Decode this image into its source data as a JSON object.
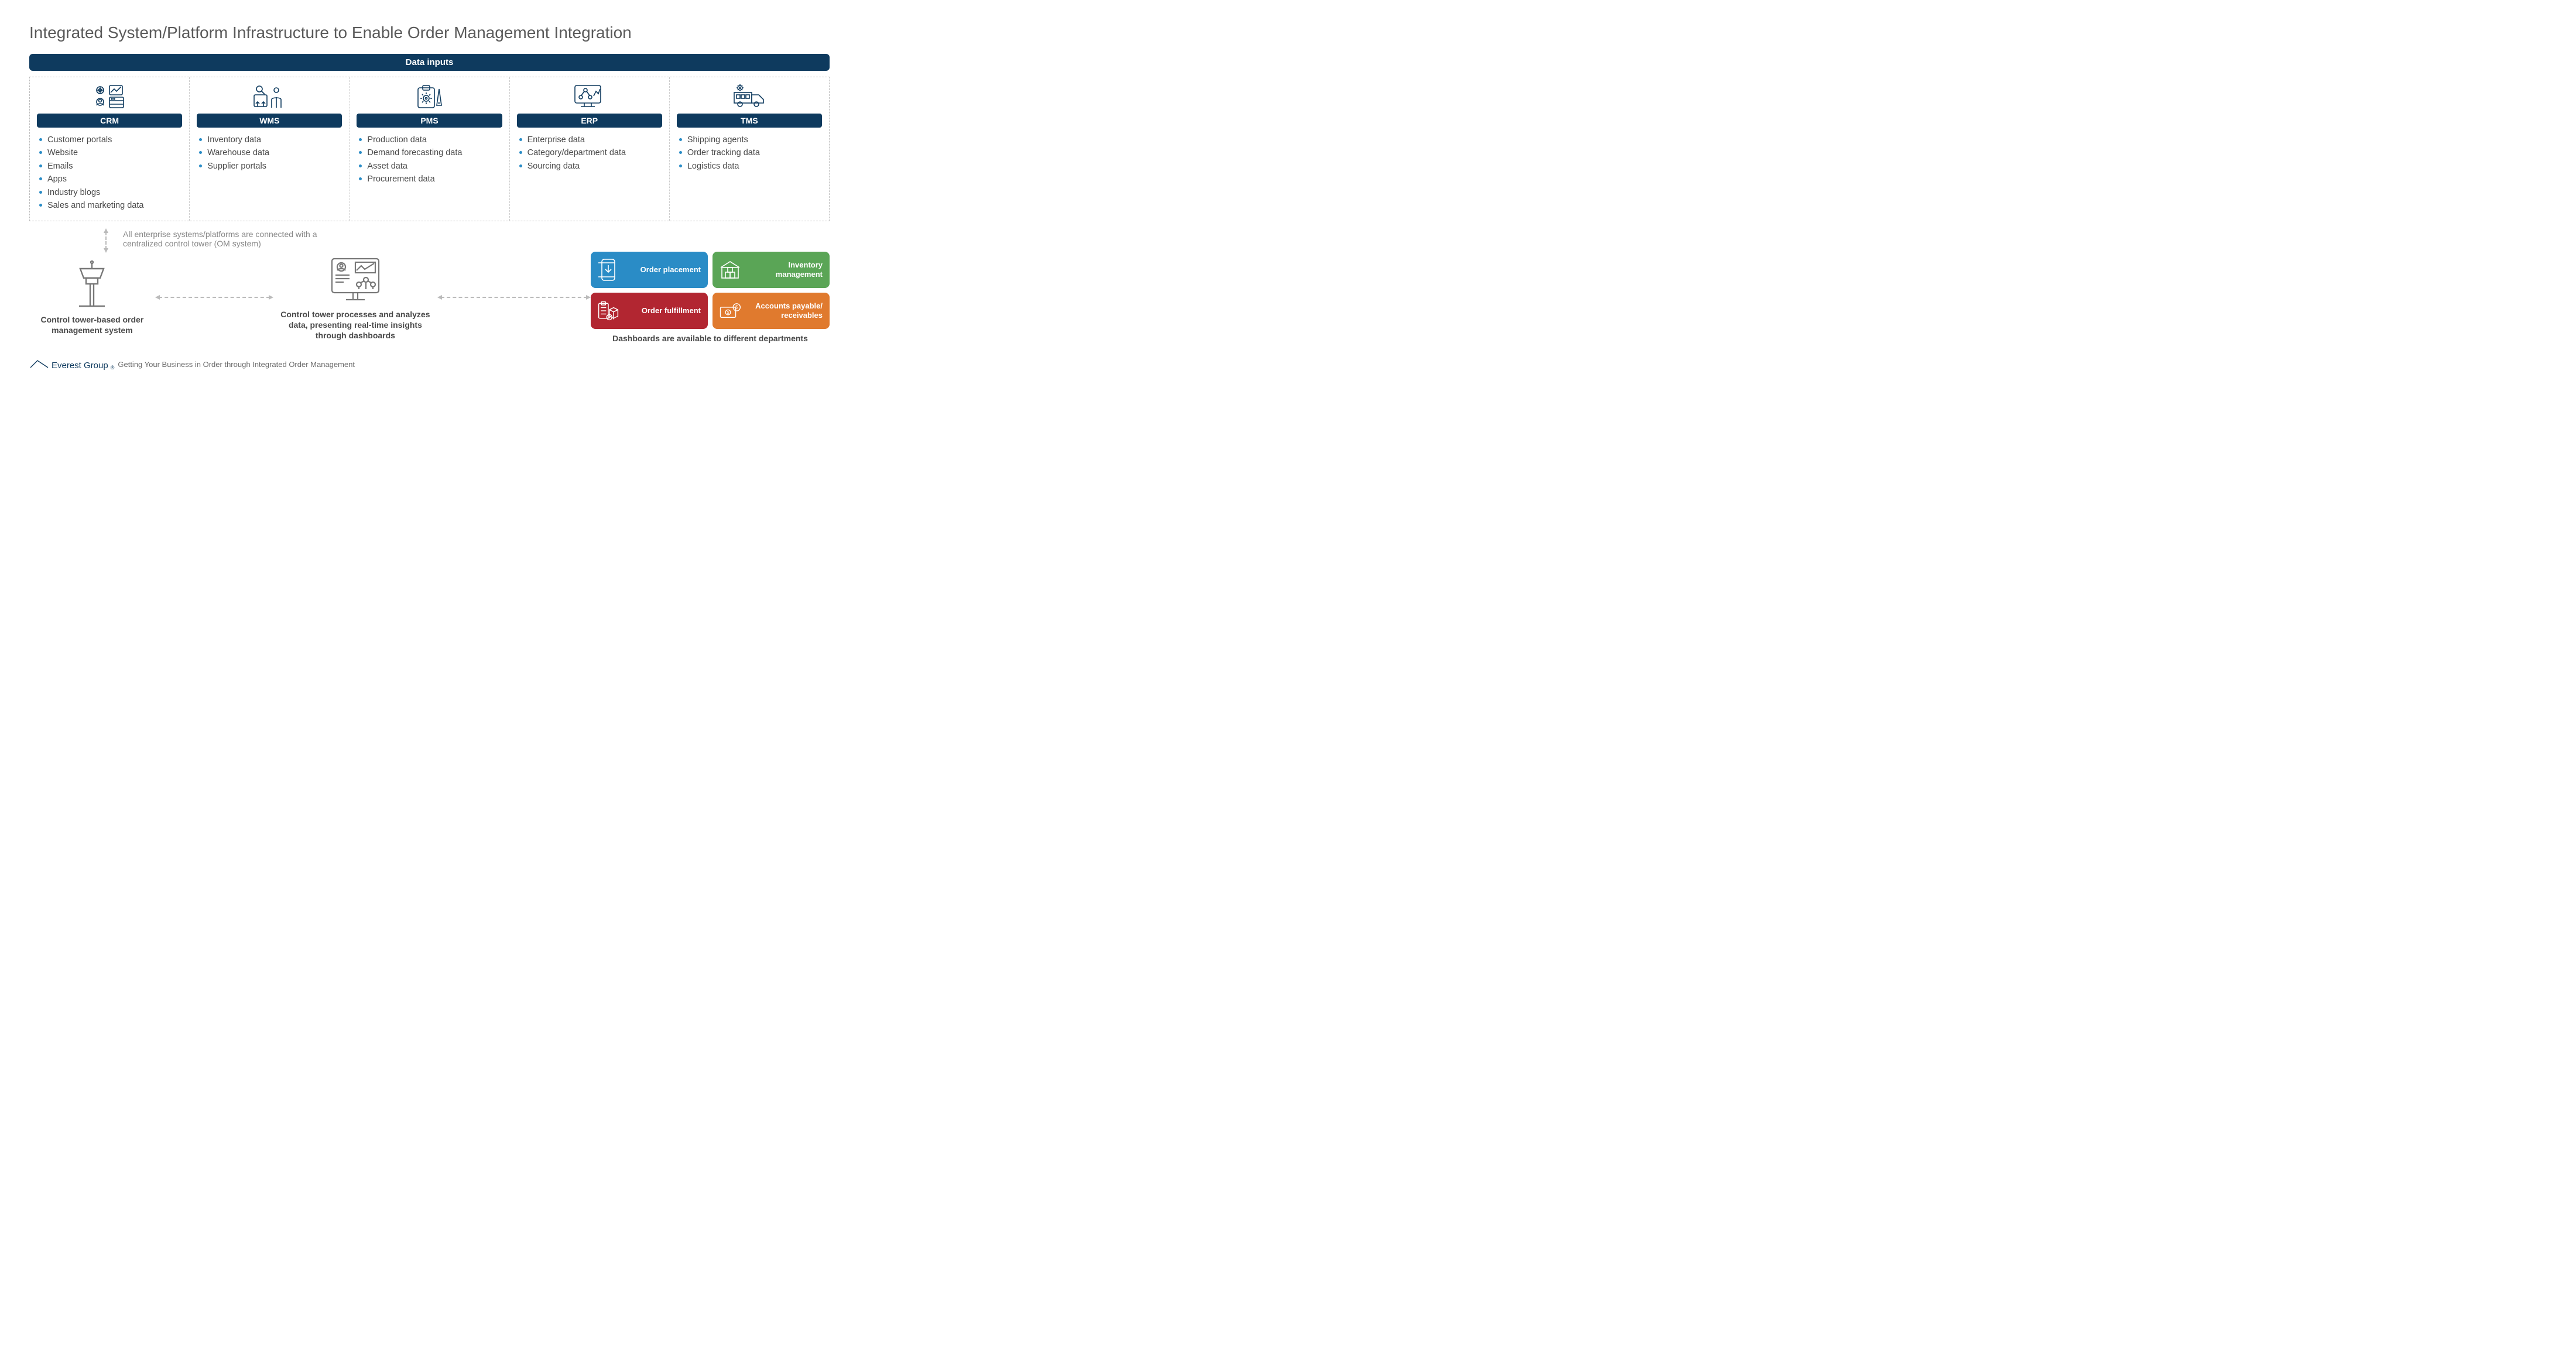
{
  "title": "Integrated System/Platform Infrastructure to Enable Order Management Integration",
  "data_inputs_label": "Data inputs",
  "systems": [
    {
      "code": "CRM",
      "items": [
        "Customer portals",
        "Website",
        "Emails",
        "Apps",
        "Industry blogs",
        "Sales and marketing data"
      ]
    },
    {
      "code": "WMS",
      "items": [
        "Inventory data",
        "Warehouse data",
        "Supplier portals"
      ]
    },
    {
      "code": "PMS",
      "items": [
        "Production data",
        "Demand forecasting data",
        "Asset data",
        "Procurement data"
      ]
    },
    {
      "code": "ERP",
      "items": [
        "Enterprise data",
        "Category/department data",
        "Sourcing data"
      ]
    },
    {
      "code": "TMS",
      "items": [
        "Shipping agents",
        "Order tracking data",
        "Logistics data"
      ]
    }
  ],
  "connector_note": "All enterprise systems/platforms are connected with a centralized control tower (OM system)",
  "flow": {
    "tower_caption": "Control tower-based order management system",
    "dashboard_caption": "Control tower processes and analyzes data, presenting real-time insights through dashboards",
    "departments_caption": "Dashboards are available to different departments"
  },
  "departments": [
    {
      "label": "Order placement",
      "color": "c-blue"
    },
    {
      "label": "Inventory management",
      "color": "c-green"
    },
    {
      "label": "Order fulfillment",
      "color": "c-red"
    },
    {
      "label": "Accounts payable/ receivables",
      "color": "c-orange"
    }
  ],
  "footer": {
    "brand": "Everest Group",
    "tagline": "Getting Your Business in Order through Integrated Order Management"
  }
}
